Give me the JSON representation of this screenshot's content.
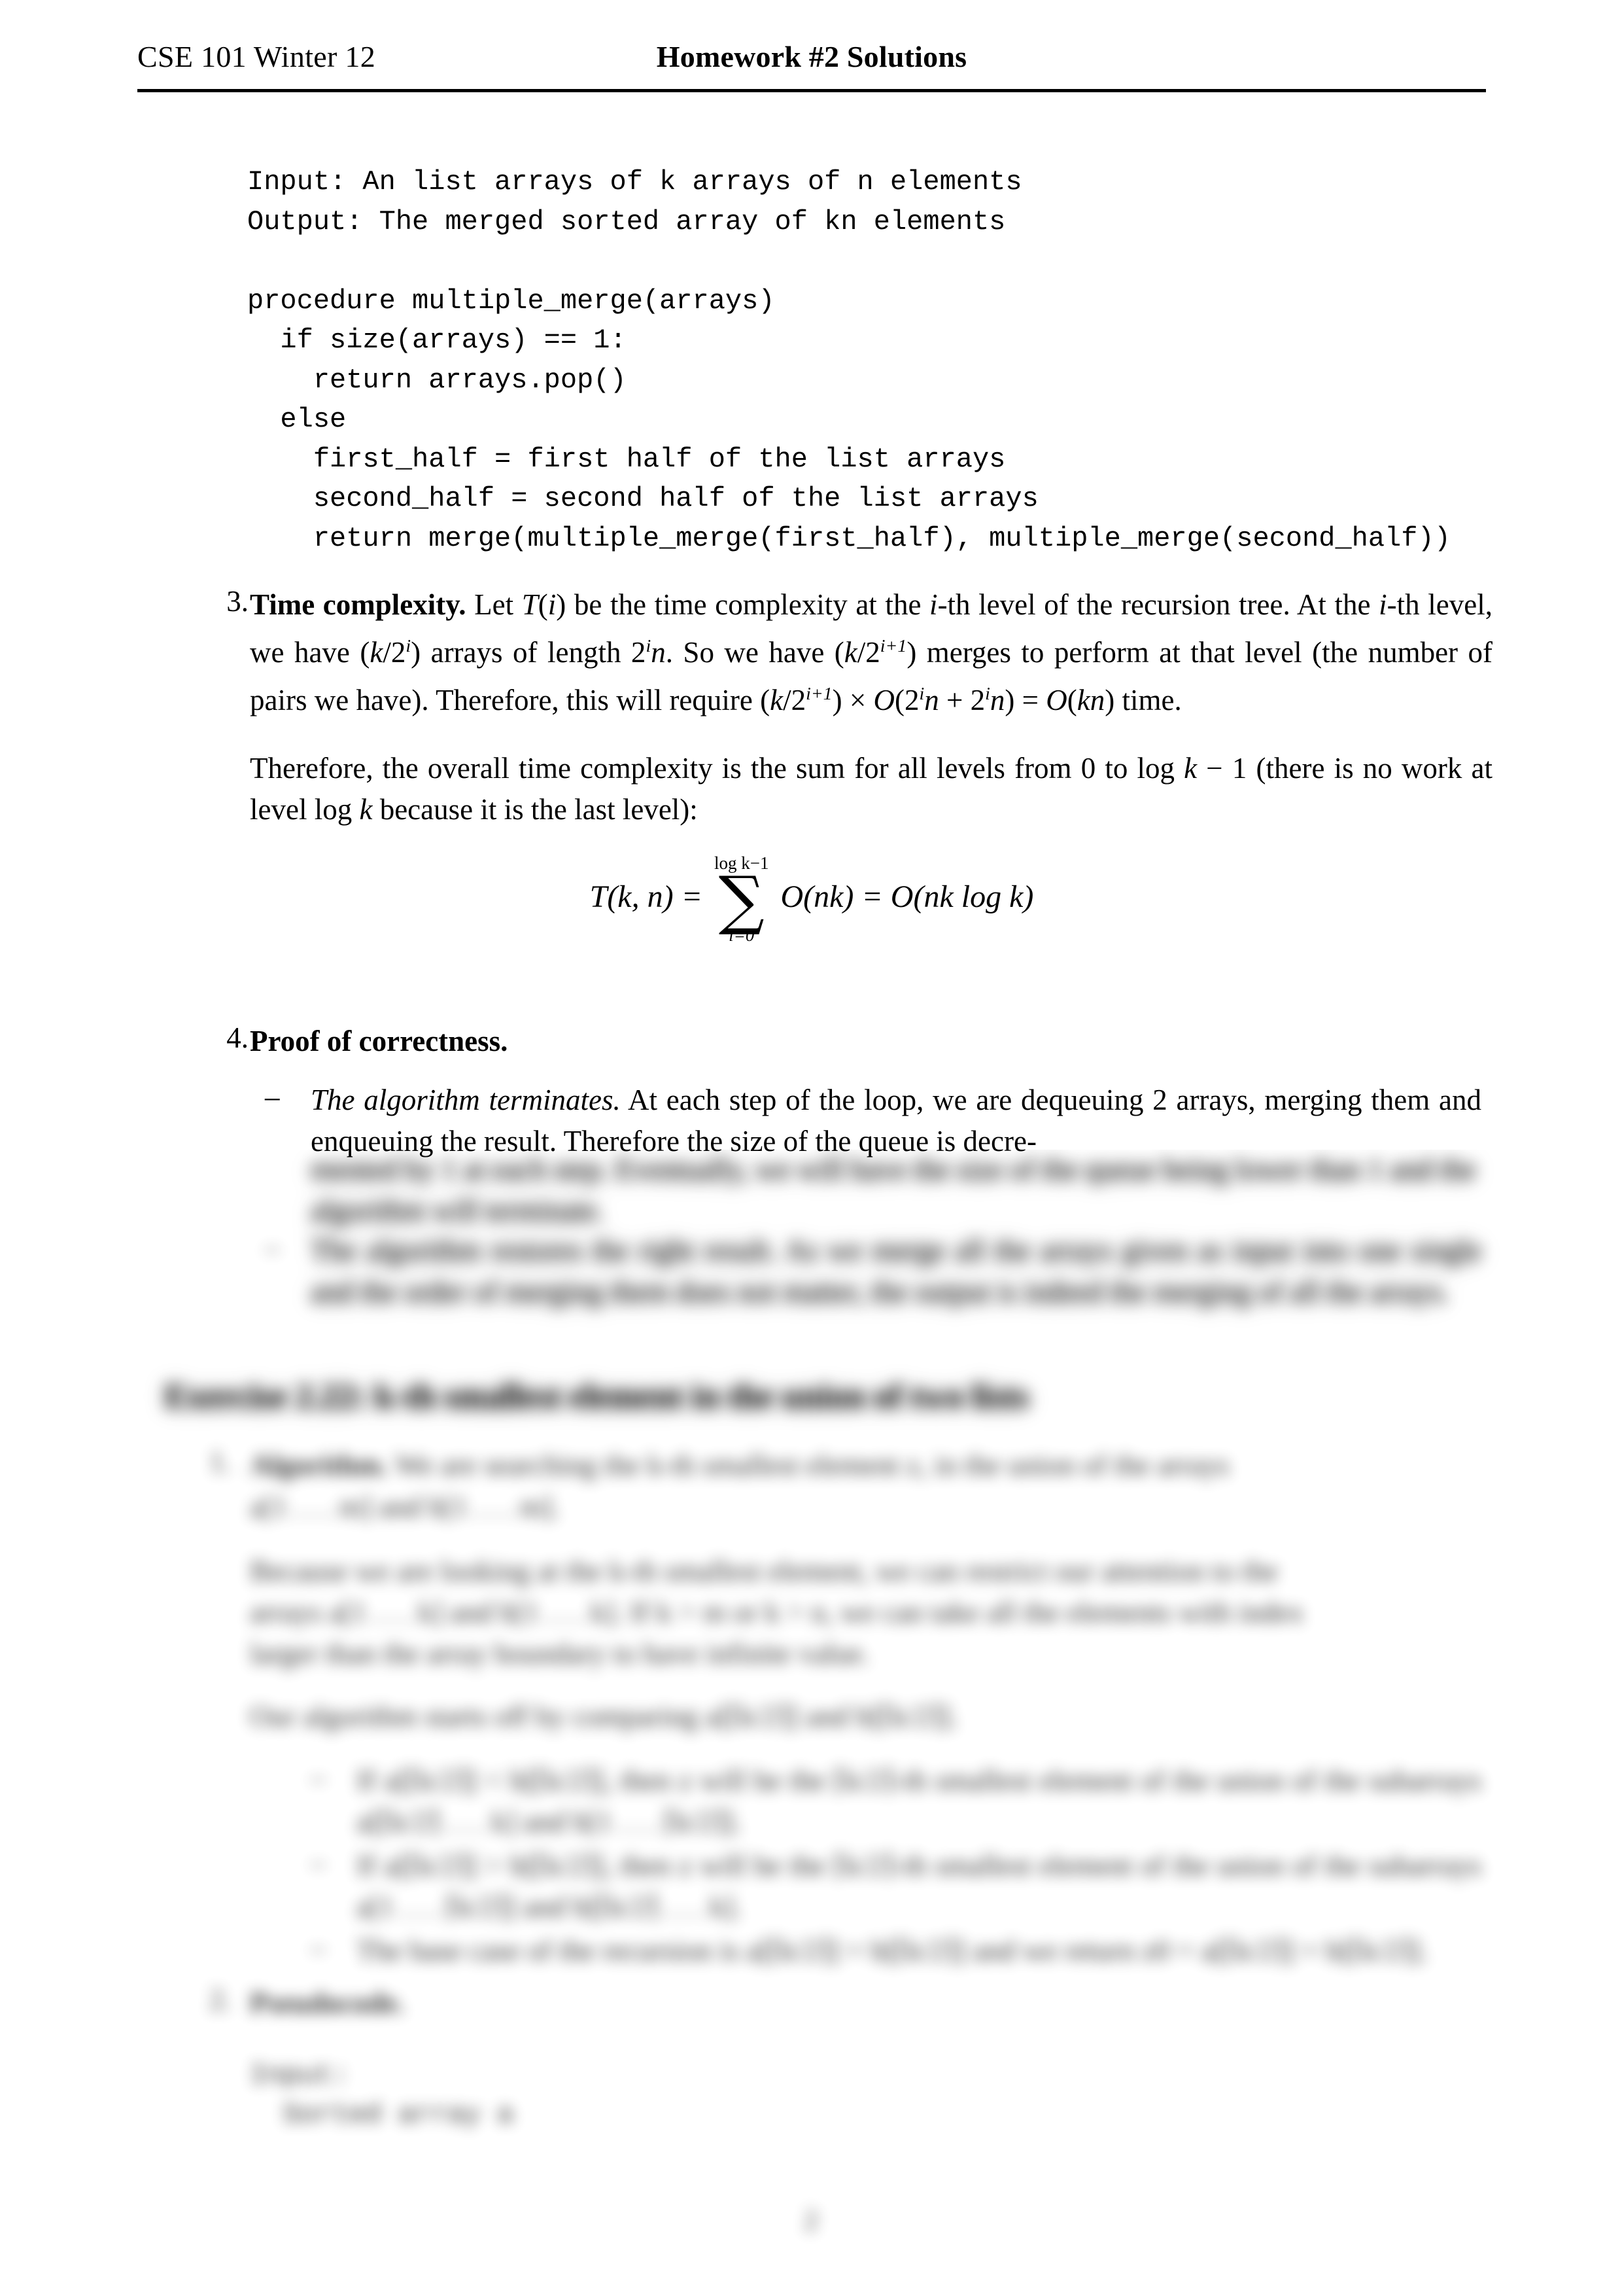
{
  "header": {
    "left": "CSE 101 Winter 12",
    "center": "Homework #2 Solutions"
  },
  "code_block": {
    "lines": [
      "Input: An list arrays of k arrays of n elements",
      "Output: The merged sorted array of kn elements",
      "",
      "procedure multiple_merge(arrays)",
      "  if size(arrays) == 1:",
      "    return arrays.pop()",
      "  else",
      "    first_half = first half of the list arrays",
      "    second_half = second half of the list arrays",
      "    return merge(multiple_merge(first_half), multiple_merge(second_half))"
    ]
  },
  "item3": {
    "number": "3.",
    "lead": "Time complexity.",
    "para1_a": " Let ",
    "para1_T": "T",
    "para1_b": "(",
    "para1_i": "i",
    "para1_c": ") be the time complexity at the ",
    "para1_i2": "i",
    "para1_d": "-th level of the recursion tree. At the ",
    "para1_i3": "i",
    "para1_e": "-th level, we have (",
    "para1_k": "k",
    "para1_f": "/2",
    "para1_sup1": "i",
    "para1_g": ") arrays of length 2",
    "para1_sup2": "i",
    "para1_n": "n",
    "para1_h": ". So we have (",
    "para1_k2": "k",
    "para1_j": "/2",
    "para1_sup3": "i+1",
    "para1_l": ") merges to perform at that level (the number of pairs we have). Therefore, this will require (",
    "para1_k3": "k",
    "para1_m": "/2",
    "para1_sup4": "i+1",
    "para1_o": ") × ",
    "para1_O1": "O",
    "para1_p": "(2",
    "para1_sup5": "i",
    "para1_n2": "n",
    "para1_q": " + 2",
    "para1_sup6": "i",
    "para1_n3": "n",
    "para1_r": ") = ",
    "para1_O2": "O",
    "para1_s": "(",
    "para1_kn": "kn",
    "para1_t": ") time.",
    "para2_a": "Therefore, the overall time complexity is the sum for all levels from 0 to log ",
    "para2_k": "k",
    "para2_b": " − 1 (there is no work at level log ",
    "para2_k2": "k",
    "para2_c": " because it is the last level):"
  },
  "equation": {
    "lhs_T": "T",
    "lhs_rest": "(k, n) =",
    "sum_upper": "log k−1",
    "sum_sign": "∑",
    "sum_lower": "i=0",
    "summand": "O(nk) = O(nk log k)"
  },
  "item4": {
    "number": "4.",
    "lead": "Proof of correctness.",
    "bullets": [
      {
        "mark": "–",
        "italic": "The algorithm terminates.",
        "text": " At each step of the loop, we are dequeuing 2 arrays, merging them and enqueuing the result. Therefore the size of the queue is decre-",
        "text_cont": "mented by 1 at each step. Eventually, we will have the size of the queue being lower than 1 and the algorithm will terminate."
      },
      {
        "mark": "–",
        "italic": "",
        "text": "The algorithm restores the right result. As we merge all the arrays given as input into one single and the order of merging them does not matter, the output is indeed the merging of all the arrays."
      }
    ]
  },
  "exercise": {
    "heading_bold": "Exercise 2.22:",
    "heading_rest": " k-th smallest element in the union of two lists",
    "items": [
      {
        "number": "1.",
        "lead": "Algorithm.",
        "lines": [
          "We are searching the k-th smallest element z, in the union of the arrays",
          "a[1 . . . m] and b[1 . . . m].",
          "Because we are looking at the k-th smallest element, we can restrict our attention to the",
          "arrays a[1 . . . k] and b[1 . . . k]. If k > m or k > n, we can take all the elements with index",
          "larger than the array boundary to have infinite value.",
          "Our algorithm starts off by comparing a[⌈k/2⌉] and b[⌈k/2⌉]."
        ],
        "sub_bullets": [
          "If a[⌈k/2⌉] < b[⌈k/2⌉], then z will be the ⌈k/2⌉-th smallest element of the union of the subarrays a[⌈k/2⌉ . . . k] and b[1 . . . ⌈k/2⌉].",
          "If a[⌈k/2⌉] > b[⌈k/2⌉], then z will be the ⌈k/2⌉-th smallest element of the union of the subarrays a[1 . . . ⌈k/2⌉] and b[⌈k/2⌉ . . . k].",
          "The base case of the recursion is a[⌈k/2⌉] = b[⌈k/2⌉] and we return z0 = a[⌈k/2⌉] = b[⌈k/2⌉]."
        ]
      },
      {
        "number": "2.",
        "lead": "Pseudocode.",
        "lines": [
          "Input:",
          "  Sorted array a"
        ]
      }
    ]
  },
  "page_number": "2"
}
